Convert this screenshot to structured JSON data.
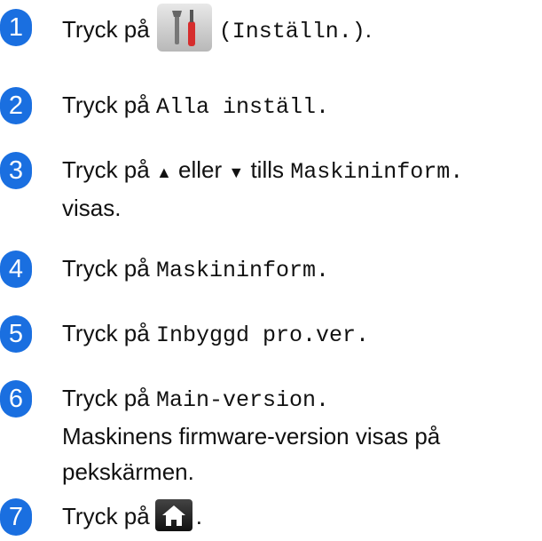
{
  "steps": [
    {
      "number": "1",
      "parts": [
        "Tryck på",
        "(Inställn.)",
        "."
      ]
    },
    {
      "number": "2",
      "parts": [
        "Tryck på",
        "Alla inställ."
      ]
    },
    {
      "number": "3",
      "parts": [
        "Tryck på",
        "▲",
        "eller",
        "▼",
        "tills",
        "Maskininform.",
        "visas."
      ]
    },
    {
      "number": "4",
      "parts": [
        "Tryck på",
        "Maskininform."
      ]
    },
    {
      "number": "5",
      "parts": [
        "Tryck på",
        "Inbyggd pro.ver."
      ]
    },
    {
      "number": "6",
      "parts": [
        "Tryck på",
        "Main-version.",
        "Maskinens firmware-version visas på",
        "pekskärmen."
      ]
    },
    {
      "number": "7",
      "parts": [
        "Tryck på",
        "."
      ]
    }
  ],
  "icons": {
    "settings": "settings-tools-icon",
    "home": "home-icon"
  },
  "colors": {
    "bullet": "#1a6fe0"
  }
}
